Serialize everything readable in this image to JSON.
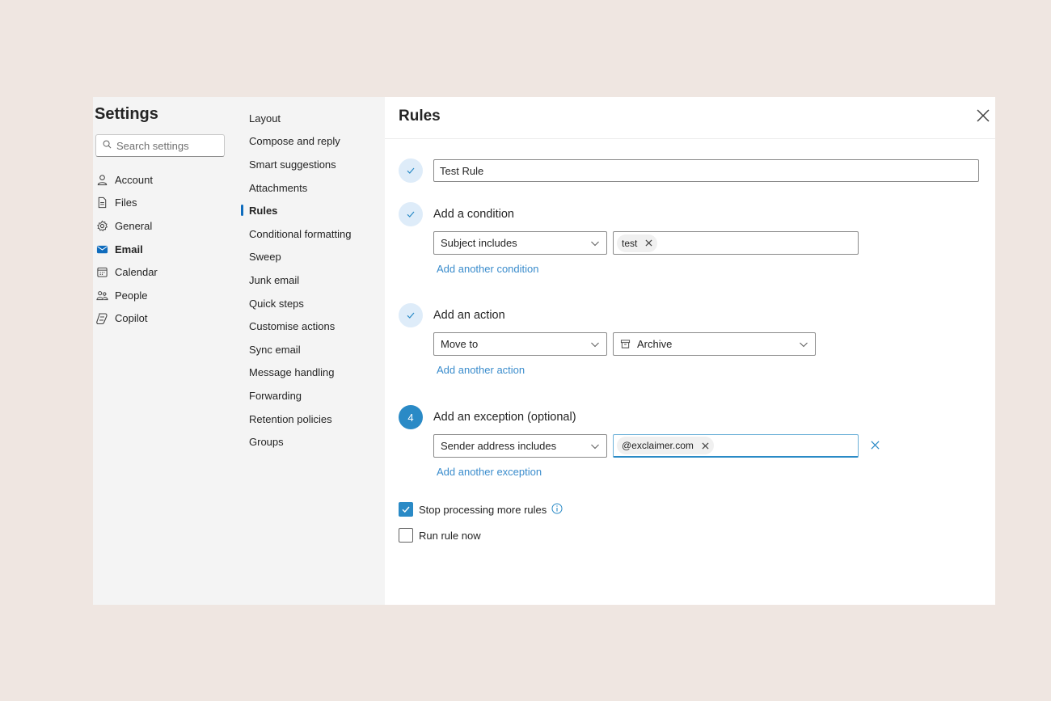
{
  "settings": {
    "title": "Settings",
    "search_placeholder": "Search settings",
    "categories": [
      {
        "label": "Account",
        "icon": "person-icon"
      },
      {
        "label": "Files",
        "icon": "document-icon"
      },
      {
        "label": "General",
        "icon": "gear-icon"
      },
      {
        "label": "Email",
        "icon": "mail-icon",
        "active": true
      },
      {
        "label": "Calendar",
        "icon": "calendar-icon"
      },
      {
        "label": "People",
        "icon": "people-icon"
      },
      {
        "label": "Copilot",
        "icon": "copilot-icon"
      }
    ]
  },
  "email_nav": {
    "items": [
      "Layout",
      "Compose and reply",
      "Smart suggestions",
      "Attachments",
      "Rules",
      "Conditional formatting",
      "Sweep",
      "Junk email",
      "Quick steps",
      "Customise actions",
      "Sync email",
      "Message handling",
      "Forwarding",
      "Retention policies",
      "Groups"
    ],
    "active": "Rules"
  },
  "rules": {
    "title": "Rules",
    "rule_name": "Test Rule",
    "condition": {
      "title": "Add a condition",
      "field": "Subject includes",
      "chip": "test",
      "add_link": "Add another condition"
    },
    "action": {
      "title": "Add an action",
      "field": "Move to",
      "folder": "Archive",
      "add_link": "Add another action"
    },
    "exception": {
      "step_number": "4",
      "title": "Add an exception (optional)",
      "field": "Sender address includes",
      "chip": "@exclaimer.com",
      "add_link": "Add another exception"
    },
    "stop_processing": {
      "label": "Stop processing more rules",
      "checked": true
    },
    "run_now": {
      "label": "Run rule now",
      "checked": false
    }
  },
  "colors": {
    "accent": "#2a8ac6",
    "link": "#3a8ccc",
    "active_nav_bar": "#0f6cbd",
    "background": "#efe6e1"
  }
}
